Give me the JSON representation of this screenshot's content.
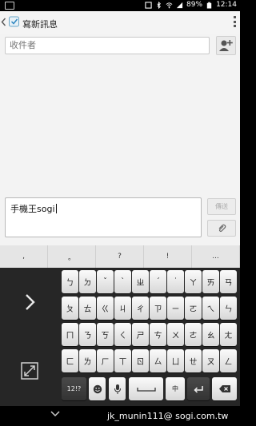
{
  "status_bar": {
    "battery": "89%",
    "time": "12:14"
  },
  "header": {
    "title": "寫新訊息",
    "back_icon": "chevron-left-icon",
    "app_icon": "compose-message-icon",
    "menu_icon": "overflow-menu-icon"
  },
  "recipient": {
    "placeholder": "收件者",
    "add_contact_icon": "add-contact-icon"
  },
  "message": {
    "value": "手機王sogi"
  },
  "send_label": "傳送",
  "attach_icon": "paperclip-icon",
  "keyboard": {
    "punctuation": [
      ",",
      "。",
      "?",
      "!",
      "..."
    ],
    "row1": [
      "ㄅ",
      "ㄉ",
      "ˇ",
      "ˋ",
      "ㄓ",
      "ˊ",
      "˙",
      "ㄚ",
      "ㄞ",
      "ㄢ"
    ],
    "row2": [
      "ㄆ",
      "ㄊ",
      "ㄍ",
      "ㄐ",
      "ㄔ",
      "ㄗ",
      "ㄧ",
      "ㄛ",
      "ㄟ",
      "ㄣ"
    ],
    "row3": [
      "ㄇ",
      "ㄋ",
      "ㄎ",
      "ㄑ",
      "ㄕ",
      "ㄘ",
      "ㄨ",
      "ㄜ",
      "ㄠ",
      "ㄤ"
    ],
    "row4": [
      "ㄈ",
      "ㄌ",
      "ㄏ",
      "ㄒ",
      "ㄖ",
      "ㄙ",
      "ㄩ",
      "ㄝ",
      "ㄡ",
      "ㄥ"
    ],
    "bottom": {
      "numbers_label": "12!?",
      "emoji_icon": "smiley-icon",
      "mic_icon": "microphone-icon",
      "space_icon": "space-bar-icon",
      "language_label": "中",
      "enter_icon": "enter-icon",
      "delete_icon": "backspace-icon"
    },
    "side_arrow_icon": "chevron-right-icon",
    "expand_icon": "expand-icon"
  },
  "nav": {
    "hide_keyboard_icon": "chevron-down-icon"
  },
  "watermark": "jk_munin111@ sogi.com.tw"
}
